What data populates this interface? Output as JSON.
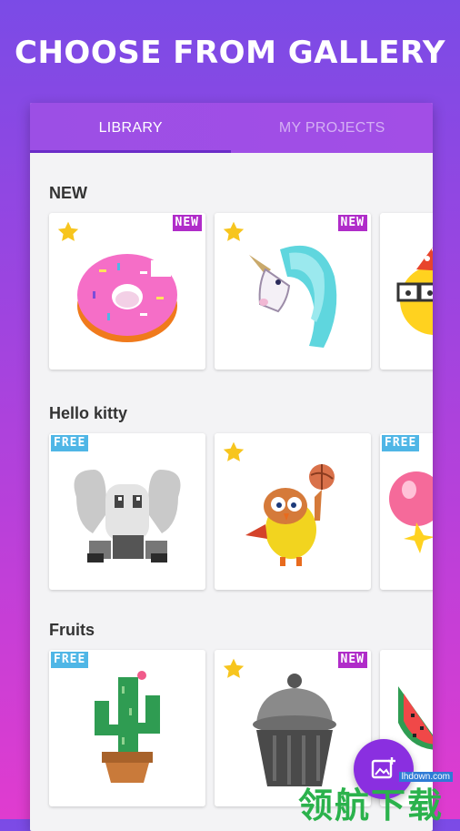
{
  "headline": "CHOOSE FROM GALLERY",
  "tabs": [
    {
      "label": "LIBRARY",
      "active": true
    },
    {
      "label": "MY PROJECTS",
      "active": false
    }
  ],
  "sections": [
    {
      "title": "NEW",
      "cards": [
        {
          "subject": "donut",
          "badge": "NEW",
          "starred": true
        },
        {
          "subject": "unicorn",
          "badge": "NEW",
          "starred": true
        },
        {
          "subject": "emoji with party hat",
          "badge": "",
          "starred": false
        }
      ]
    },
    {
      "title": "Hello kitty",
      "cards": [
        {
          "subject": "grey bunny",
          "badge": "FREE",
          "starred": false
        },
        {
          "subject": "bird with basketball",
          "badge": "",
          "starred": true
        },
        {
          "subject": "balloon",
          "badge": "FREE",
          "starred": false
        }
      ]
    },
    {
      "title": "Fruits",
      "cards": [
        {
          "subject": "cactus",
          "badge": "FREE",
          "starred": false
        },
        {
          "subject": "cupcake",
          "badge": "NEW",
          "starred": true
        },
        {
          "subject": "watermelon",
          "badge": "",
          "starred": false
        }
      ]
    }
  ],
  "fab": {
    "icon": "add-image-icon"
  },
  "watermark": {
    "url": "lhdown.com",
    "text": "领航下载"
  },
  "colors": {
    "accent": "#9c4fe5",
    "badge_new": "#b02cc9",
    "badge_free": "#4fb6e6",
    "star": "#f7c51e"
  }
}
